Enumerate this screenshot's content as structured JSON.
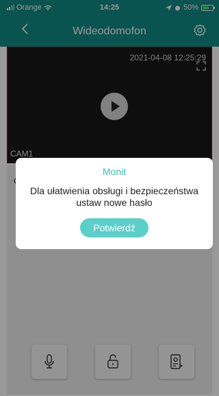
{
  "status_bar": {
    "carrier": "Orange",
    "time": "14:25",
    "battery": "50%"
  },
  "nav": {
    "title": "Wideodomofon"
  },
  "video": {
    "timestamp": "2021-04-08 12:25:29",
    "camera": "CAM1"
  },
  "panel": {
    "partial_text": "C"
  },
  "dialog": {
    "title": "Monit",
    "message": "Dla ułatwienia obsługi i bezpieczeństwa ustaw nowe hasło",
    "confirm_label": "Potwierdź"
  },
  "colors": {
    "accent": "#0f8b85",
    "dialog_accent": "#3dbdb7",
    "button": "#5ccfc9"
  },
  "icons": {
    "back": "chevron-left-icon",
    "settings": "gear-icon",
    "play": "play-icon",
    "expand": "expand-icon",
    "mic": "microphone-icon",
    "unlock": "unlock-icon",
    "intercom": "intercom-icon"
  }
}
